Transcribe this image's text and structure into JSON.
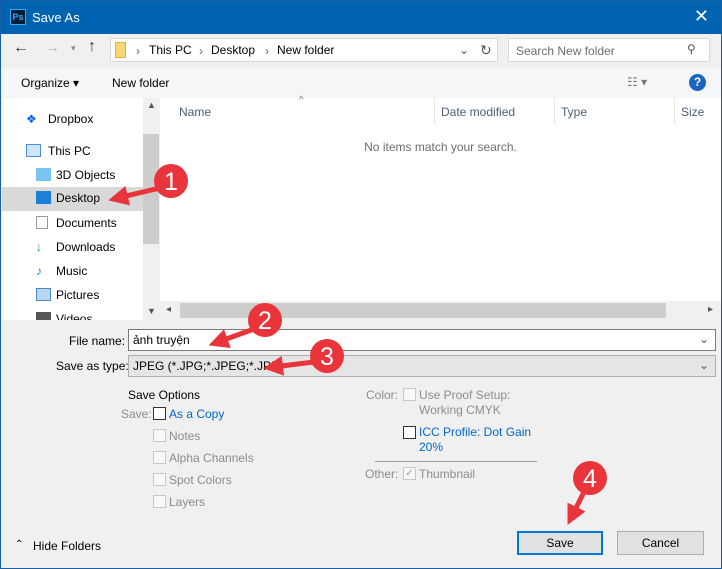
{
  "window": {
    "title": "Save As",
    "app_icon": "Ps",
    "close": "✕"
  },
  "address": {
    "crumbs": [
      "This PC",
      "Desktop",
      "New folder"
    ],
    "search_placeholder": "Search New folder"
  },
  "toolbar": {
    "organize": "Organize ▾",
    "new_folder": "New folder",
    "help": "?"
  },
  "nav": {
    "items": [
      {
        "label": "Dropbox",
        "icon": "dropbox-icon"
      },
      {
        "label": "This PC",
        "icon": "computer-icon"
      },
      {
        "label": "3D Objects",
        "icon": "cube-icon"
      },
      {
        "label": "Desktop",
        "icon": "desktop-icon",
        "selected": true
      },
      {
        "label": "Documents",
        "icon": "documents-icon"
      },
      {
        "label": "Downloads",
        "icon": "download-icon"
      },
      {
        "label": "Music",
        "icon": "music-icon"
      },
      {
        "label": "Pictures",
        "icon": "pictures-icon"
      },
      {
        "label": "Videos",
        "icon": "video-icon"
      }
    ]
  },
  "list": {
    "columns": [
      "Name",
      "Date modified",
      "Type",
      "Size"
    ],
    "empty": "No items match your search."
  },
  "form": {
    "file_name_label": "File name:",
    "file_name": "ảnh truyện",
    "type_label": "Save as type:",
    "type": "JPEG (*.JPG;*.JPEG;*.JPE)"
  },
  "options": {
    "title": "Save Options",
    "save_label": "Save:",
    "as_copy": "As a Copy",
    "notes": "Notes",
    "alpha": "Alpha Channels",
    "spot": "Spot Colors",
    "layers": "Layers",
    "color_label": "Color:",
    "proof1": "Use Proof Setup:",
    "proof2": "Working CMYK",
    "icc1": "ICC Profile:  Dot Gain",
    "icc2": "20%",
    "other_label": "Other:",
    "thumbnail": "Thumbnail",
    "thumbnail_checked": true
  },
  "footer": {
    "hide_folders": "Hide Folders",
    "save": "Save",
    "cancel": "Cancel"
  },
  "annotations": [
    "1",
    "2",
    "3",
    "4"
  ],
  "colors": {
    "titlebar": "#0063b1",
    "annotation": "#e8343a"
  }
}
